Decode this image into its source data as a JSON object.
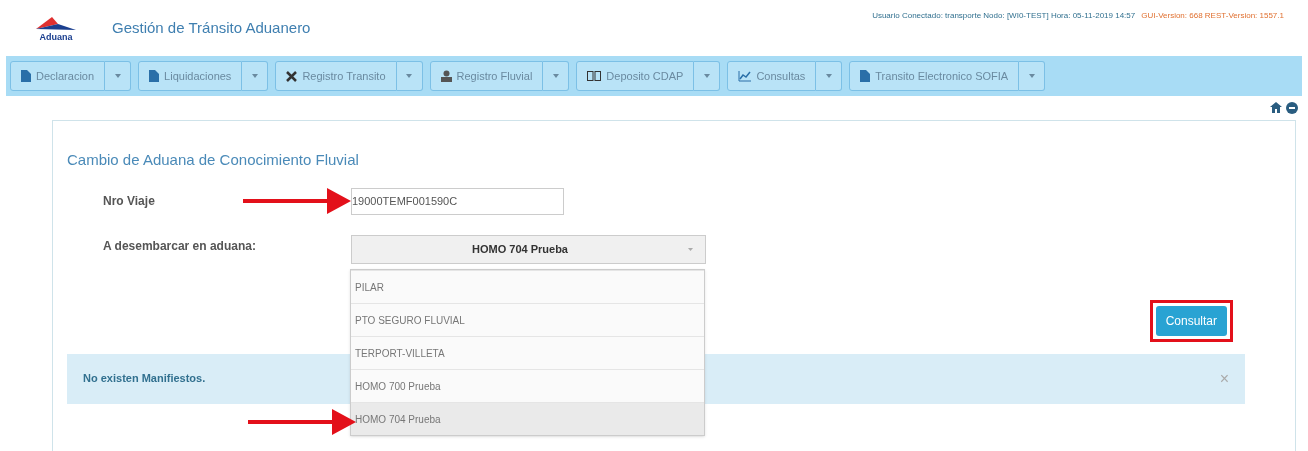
{
  "header": {
    "logo_text": "Aduana",
    "title": "Gestión de Tránsito Aduanero",
    "session": "Usuario Conectado: transporte  Nodo: [WI0-TEST]  Hora: 05-11-2019 14:57",
    "versions": "GUI-Version: 668  REST-Version: 1557.1"
  },
  "menu": [
    {
      "label": "Declaracion",
      "kind": "file"
    },
    {
      "label": "Liquidaciones",
      "kind": "file"
    },
    {
      "label": "Registro Transito",
      "kind": "cross"
    },
    {
      "label": "Registro Fluvial",
      "kind": "person"
    },
    {
      "label": "Deposito CDAP",
      "kind": "boxes"
    },
    {
      "label": "Consultas",
      "kind": "chart"
    },
    {
      "label": "Transito Electronico SOFIA",
      "kind": "file"
    }
  ],
  "form": {
    "title": "Cambio de Aduana de Conocimiento Fluvial",
    "trip_label": "Nro Viaje",
    "trip_value": "19000TEMF001590C",
    "customs_label": "A desembarcar en aduana:",
    "customs_value": "HOMO 704 Prueba",
    "options": [
      {
        "label": "PILAR",
        "selected": false
      },
      {
        "label": "PTO SEGURO FLUVIAL",
        "selected": false
      },
      {
        "label": "TERPORT-VILLETA",
        "selected": false
      },
      {
        "label": "HOMO 700 Prueba",
        "selected": false
      },
      {
        "label": "HOMO 704 Prueba",
        "selected": true
      }
    ],
    "button": "Consultar",
    "alert": "No existen Manifiestos.",
    "alert_close": "×"
  }
}
